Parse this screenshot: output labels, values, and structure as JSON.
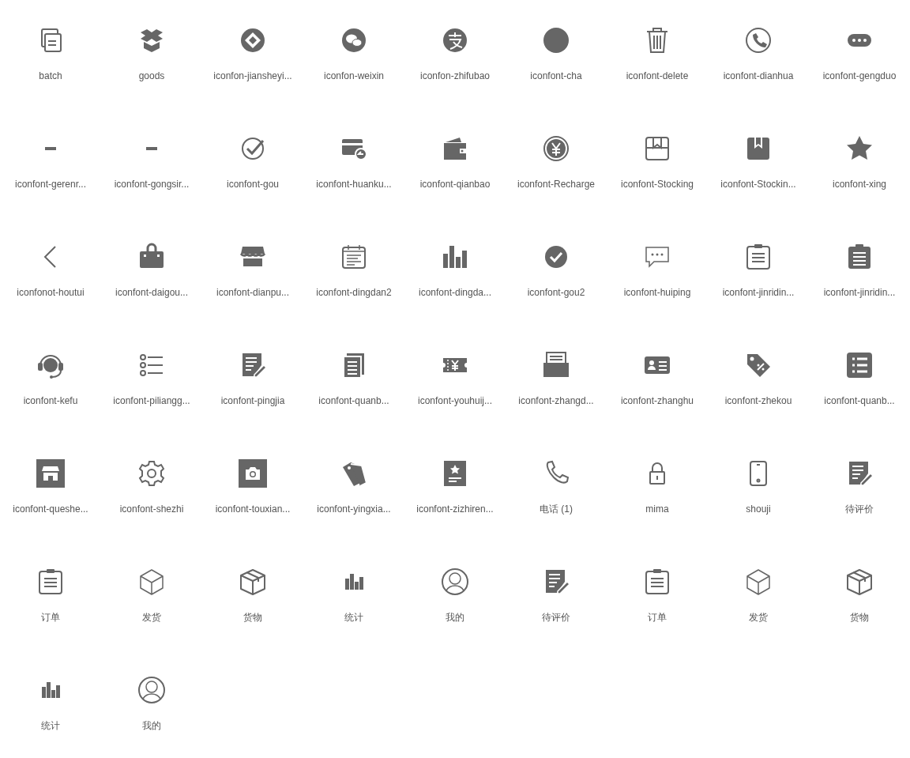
{
  "icons": [
    {
      "label": "batch",
      "kind": "copy"
    },
    {
      "label": "goods",
      "kind": "box-open"
    },
    {
      "label": "iconfon-jiansheyi...",
      "kind": "diamond-circle"
    },
    {
      "label": "iconfon-weixin",
      "kind": "chat-bubbles"
    },
    {
      "label": "iconfon-zhifubao",
      "kind": "pay-circle"
    },
    {
      "label": "iconfont-cha",
      "kind": "disc"
    },
    {
      "label": "iconfont-delete",
      "kind": "trash"
    },
    {
      "label": "iconfont-dianhua",
      "kind": "phone-circle"
    },
    {
      "label": "iconfont-gengduo",
      "kind": "dots"
    },
    {
      "label": "iconfont-gerenr...",
      "kind": "dash"
    },
    {
      "label": "iconfont-gongsir...",
      "kind": "dash"
    },
    {
      "label": "iconfont-gou",
      "kind": "check-outline"
    },
    {
      "label": "iconfont-huanku...",
      "kind": "card-arrow"
    },
    {
      "label": "iconfont-qianbao",
      "kind": "wallet"
    },
    {
      "label": "iconfont-Recharge",
      "kind": "yen"
    },
    {
      "label": "iconfont-Stocking",
      "kind": "bookmark-outline"
    },
    {
      "label": "iconfont-Stockin...",
      "kind": "bookmark-filled"
    },
    {
      "label": "iconfont-xing",
      "kind": "star"
    },
    {
      "label": "iconfonot-houtui",
      "kind": "chevron"
    },
    {
      "label": "iconfont-daigou...",
      "kind": "bag"
    },
    {
      "label": "iconfont-dianpu...",
      "kind": "shop"
    },
    {
      "label": "iconfont-dingdan2",
      "kind": "calendar"
    },
    {
      "label": "iconfont-dingda...",
      "kind": "bars"
    },
    {
      "label": "iconfont-gou2",
      "kind": "check-filled"
    },
    {
      "label": "iconfont-huiping",
      "kind": "comment"
    },
    {
      "label": "iconfont-jinridin...",
      "kind": "clipboard-outline"
    },
    {
      "label": "iconfont-jinridin...",
      "kind": "clipboard-filled"
    },
    {
      "label": "iconfont-kefu",
      "kind": "headset"
    },
    {
      "label": "iconfont-piliangg...",
      "kind": "list-dots"
    },
    {
      "label": "iconfont-pingjia",
      "kind": "doc-edit"
    },
    {
      "label": "iconfont-quanb...",
      "kind": "docs"
    },
    {
      "label": "iconfont-youhuij...",
      "kind": "ticket"
    },
    {
      "label": "iconfont-zhangd...",
      "kind": "drawer"
    },
    {
      "label": "iconfont-zhanghu",
      "kind": "id-card"
    },
    {
      "label": "iconfont-zhekou",
      "kind": "tag"
    },
    {
      "label": "iconfont-quanb...",
      "kind": "list-box"
    },
    {
      "label": "iconfont-queshe...",
      "kind": "shop-square"
    },
    {
      "label": "iconfont-shezhi",
      "kind": "gear"
    },
    {
      "label": "iconfont-touxian...",
      "kind": "camera-square"
    },
    {
      "label": "iconfont-yingxia...",
      "kind": "tags"
    },
    {
      "label": "iconfont-zizhiren...",
      "kind": "certificate"
    },
    {
      "label": "电话 (1)",
      "kind": "phone"
    },
    {
      "label": "mima",
      "kind": "lock"
    },
    {
      "label": "shouji",
      "kind": "mobile"
    },
    {
      "label": "待评价",
      "kind": "doc-edit"
    },
    {
      "label": "订单",
      "kind": "clipboard-outline"
    },
    {
      "label": "发货",
      "kind": "cube"
    },
    {
      "label": "货物",
      "kind": "box"
    },
    {
      "label": "统计",
      "kind": "bars-small"
    },
    {
      "label": "我的",
      "kind": "user"
    },
    {
      "label": "待评价",
      "kind": "doc-edit"
    },
    {
      "label": "订单",
      "kind": "clipboard-outline"
    },
    {
      "label": "发货",
      "kind": "cube"
    },
    {
      "label": "货物",
      "kind": "box"
    },
    {
      "label": "统计",
      "kind": "bars-small"
    },
    {
      "label": "我的",
      "kind": "user"
    }
  ]
}
